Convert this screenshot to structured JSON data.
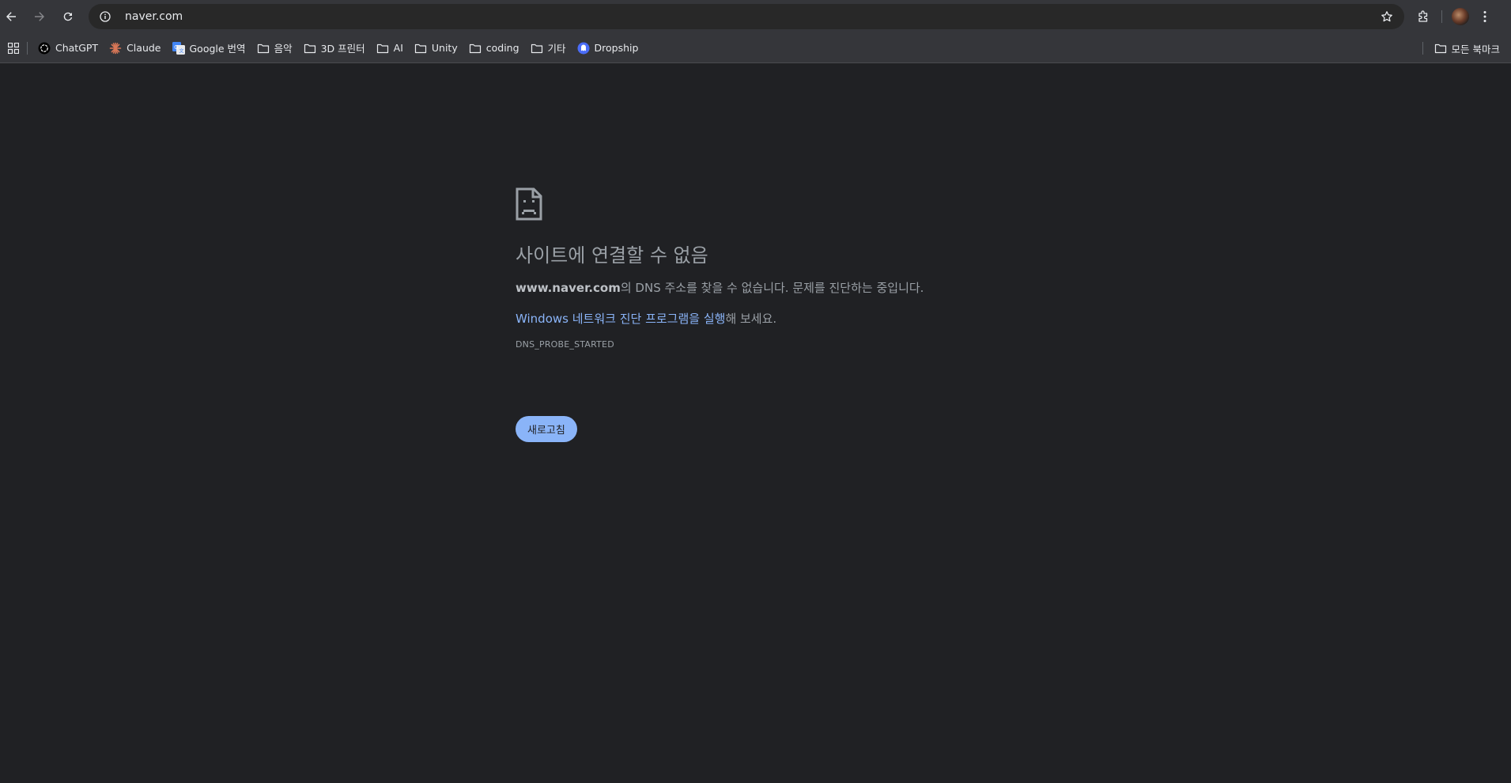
{
  "omnibox": {
    "url": "naver.com"
  },
  "bookmarks": {
    "items": [
      {
        "label": "ChatGPT",
        "icon": "chatgpt-logo-icon"
      },
      {
        "label": "Claude",
        "icon": "claude-logo-icon"
      },
      {
        "label": "Google 번역",
        "icon": "google-translate-icon"
      },
      {
        "label": "음악",
        "icon": "folder-icon"
      },
      {
        "label": "3D 프린터",
        "icon": "folder-icon"
      },
      {
        "label": "AI",
        "icon": "folder-icon"
      },
      {
        "label": "Unity",
        "icon": "folder-icon"
      },
      {
        "label": "coding",
        "icon": "folder-icon"
      },
      {
        "label": "기타",
        "icon": "folder-icon"
      },
      {
        "label": "Dropship",
        "icon": "dropship-logo-icon"
      }
    ],
    "all_bookmarks": "모든 북마크"
  },
  "error": {
    "title": "사이트에 연결할 수 없음",
    "domain": "www.naver.com",
    "message_rest": "의 DNS 주소를 찾을 수 없습니다. 문제를 진단하는 중입니다.",
    "link_text": "Windows 네트워크 진단 프로그램을 실행",
    "link_suffix": "해 보세요.",
    "code": "DNS_PROBE_STARTED",
    "reload_label": "새로고침"
  },
  "colors": {
    "page_bg": "#202124",
    "toolbar_bg": "#35363a",
    "link": "#8ab4f8",
    "button_bg": "#8ab4f8"
  }
}
